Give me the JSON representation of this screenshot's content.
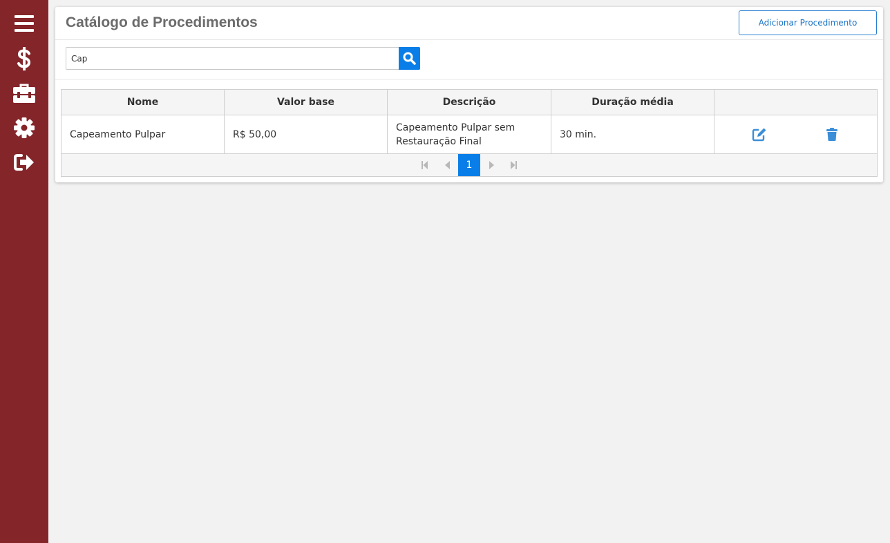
{
  "sidebar": {
    "items": [
      {
        "icon": "menu-icon"
      },
      {
        "icon": "dollar-icon"
      },
      {
        "icon": "toolbox-icon"
      },
      {
        "icon": "gear-icon"
      },
      {
        "icon": "sign-out-icon"
      }
    ],
    "background": "#84252a"
  },
  "header": {
    "title": "Catálogo de Procedimentos",
    "add_button_label": "Adicionar Procedimento"
  },
  "search": {
    "value": "Cap",
    "button_icon": "search-icon"
  },
  "table": {
    "columns": [
      "Nome",
      "Valor base",
      "Descrição",
      "Duração média",
      ""
    ],
    "rows": [
      {
        "nome": "Capeamento Pulpar",
        "valor_base": "R$ 50,00",
        "descricao": "Capeamento Pulpar sem Restauração Final",
        "duracao": "30 min.",
        "actions": [
          "edit-icon",
          "trash-icon"
        ]
      }
    ]
  },
  "pagination": {
    "current_page": "1",
    "controls": [
      "first-page-icon",
      "prev-page-icon",
      "next-page-icon",
      "last-page-icon"
    ]
  },
  "colors": {
    "accent": "#0a7ee8",
    "sidebar": "#84252a",
    "action_icon": "#3b8fd8"
  }
}
